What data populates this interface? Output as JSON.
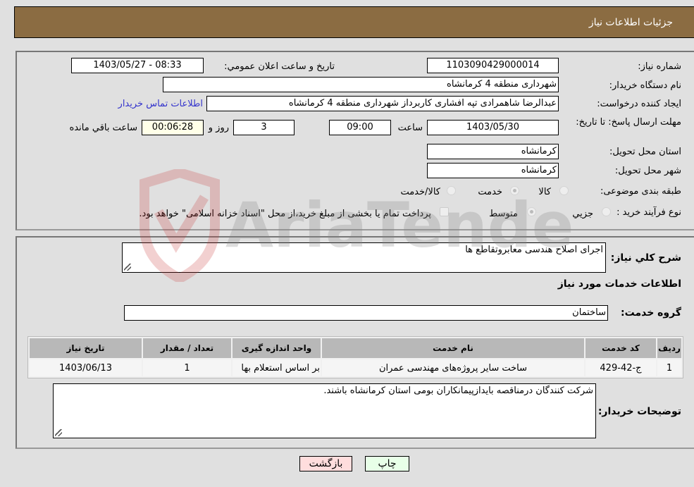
{
  "header": {
    "title": "جزئیات اطلاعات نیاز"
  },
  "details": {
    "need_number_label": "شماره نیاز:",
    "need_number": "1103090429000014",
    "announce_label": "تاریخ و ساعت اعلان عمومي:",
    "announce_value": "1403/05/27 - 08:33",
    "buyer_org_label": "نام دستگاه خریدار:",
    "buyer_org": "شهرداری منطقه 4 کرمانشاه",
    "creator_label": "ایجاد کننده درخواست:",
    "creator": "عبدالرضا شاهمرادی تپه افشاری کاربرداز شهرداری منطقه 4 کرمانشاه",
    "contact_link": "اطلاعات تماس خریدار",
    "deadline_label": "مهلت ارسال پاسخ: تا تاریخ:",
    "deadline_date": "1403/05/30",
    "time_label": "ساعت",
    "deadline_time": "09:00",
    "days_value": "3",
    "days_label": "روز و",
    "remaining_time": "00:06:28",
    "remaining_label": "ساعت باقي مانده",
    "province_label": "استان محل تحویل:",
    "province": "کرمانشاه",
    "city_label": "شهر محل تحویل:",
    "city": "کرمانشاه",
    "category_label": "طبقه بندی موضوعی:",
    "category_options": [
      "کالا",
      "خدمت",
      "کالا/خدمت"
    ],
    "category_selected": "خدمت",
    "process_label": "نوع فرآیند خرید :",
    "process_options": [
      "جزيي",
      "متوسط"
    ],
    "process_selected": "متوسط",
    "treasury_note": "پرداخت تمام یا بخشی از مبلغ خرید،از محل \"اسناد خزانه اسلامی\" خواهد بود."
  },
  "description": {
    "label": "شرح كلي نياز:",
    "value": "اجرای اصلاح هندسی معابروتقاطع ها"
  },
  "services": {
    "section_title": "اطلاعات خدمات مورد نیاز",
    "group_label": "گروه خدمت:",
    "group_value": "ساختمان",
    "columns": [
      "ردیف",
      "کد خدمت",
      "نام خدمت",
      "واحد اندازه گیری",
      "تعداد / مقدار",
      "تاریخ نیاز"
    ],
    "rows": [
      [
        "1",
        "ج-42-429",
        "ساخت سایر پروژه‌های مهندسی عمران",
        "بر اساس استعلام بها",
        "1",
        "1403/06/13"
      ]
    ]
  },
  "buyer_notes": {
    "label": "توضیحات خریدار:",
    "value": "شرکت کنندگان درمناقصه بایدازپیمانکاران بومی استان کرمانشاه باشند."
  },
  "buttons": {
    "print": "چاپ",
    "back": "بازگشت"
  },
  "watermark": {
    "text": "AriaTender.neT"
  },
  "colors": {
    "header_bg": "#8b6c42",
    "print_bg": "#e8ffe8",
    "back_bg": "#ffdddd"
  }
}
